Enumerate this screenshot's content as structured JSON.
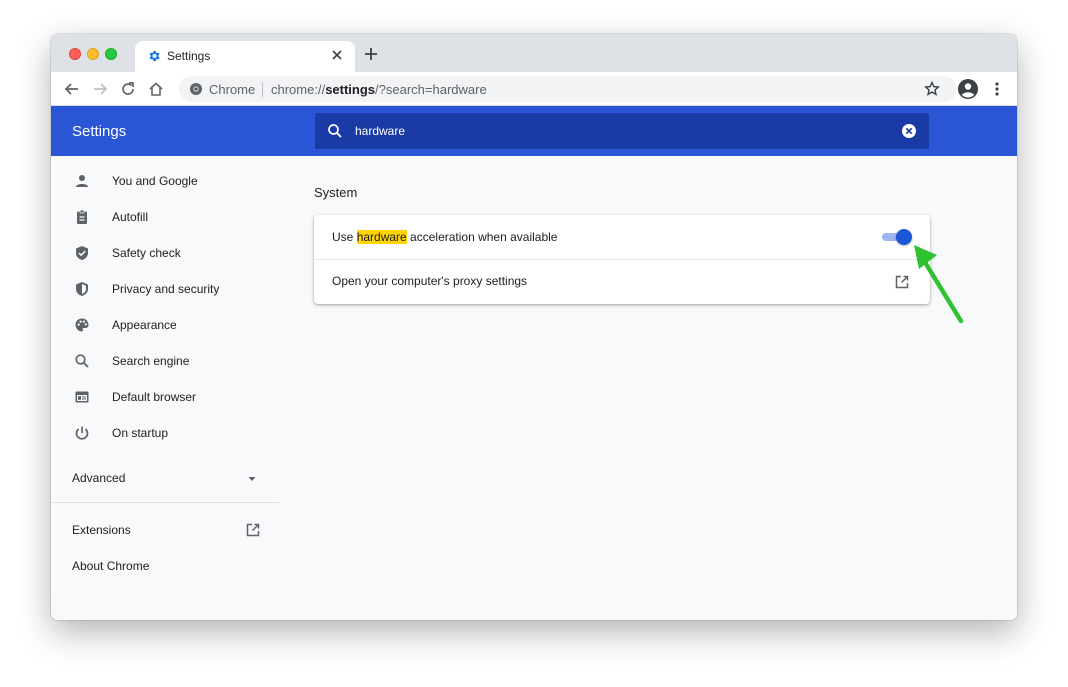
{
  "browser": {
    "tab_title": "Settings",
    "omnibox": {
      "chip": "Chrome",
      "url_prefix": "chrome://",
      "url_strong": "settings",
      "url_suffix": "/?search=hardware"
    }
  },
  "header": {
    "title": "Settings",
    "search_query": "hardware"
  },
  "sidebar": {
    "items": [
      {
        "label": "You and Google",
        "icon": "person-icon"
      },
      {
        "label": "Autofill",
        "icon": "clipboard-icon"
      },
      {
        "label": "Safety check",
        "icon": "shield-check-icon"
      },
      {
        "label": "Privacy and security",
        "icon": "shield-icon"
      },
      {
        "label": "Appearance",
        "icon": "palette-icon"
      },
      {
        "label": "Search engine",
        "icon": "search-icon"
      },
      {
        "label": "Default browser",
        "icon": "browser-icon"
      },
      {
        "label": "On startup",
        "icon": "power-icon"
      }
    ],
    "advanced": "Advanced",
    "extensions": "Extensions",
    "about": "About Chrome"
  },
  "main": {
    "section_title": "System",
    "rows": [
      {
        "label_before": "Use ",
        "label_highlight": "hardware",
        "label_after": " acceleration when available",
        "control": "toggle",
        "checked": true
      },
      {
        "label": "Open your computer's proxy settings",
        "control": "external-link"
      }
    ]
  },
  "colors": {
    "header_blue": "#2a55d4",
    "search_box": "#1a3aa6",
    "highlight": "#ffd400",
    "toggle_on": "#1a56d6",
    "annotation_arrow": "#2fc12f"
  }
}
